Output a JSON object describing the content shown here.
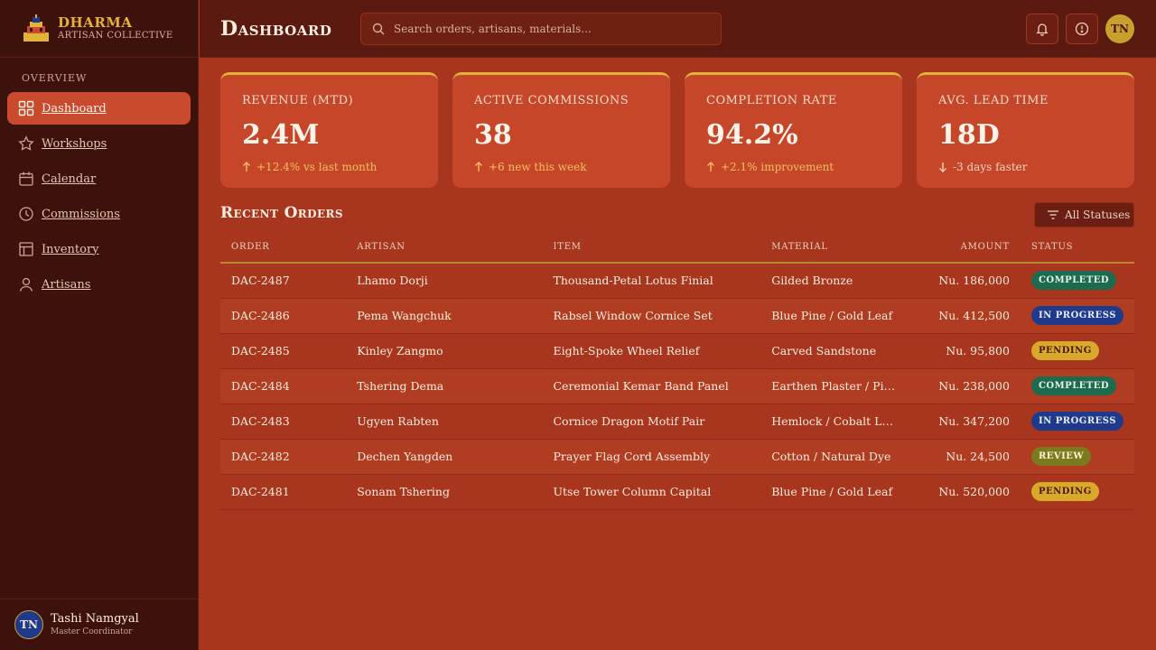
{
  "brand": {
    "name": "DHARMA",
    "subtitle": "ARTISAN COLLECTIVE"
  },
  "sidebar": {
    "section_label": "OVERVIEW",
    "items": [
      {
        "label": "Dashboard",
        "icon": "grid-icon",
        "active": true
      },
      {
        "label": "Workshops",
        "icon": "star-icon",
        "active": false
      },
      {
        "label": "Calendar",
        "icon": "calendar-icon",
        "active": false
      },
      {
        "label": "Commissions",
        "icon": "clock-icon",
        "active": false
      },
      {
        "label": "Inventory",
        "icon": "table-icon",
        "active": false
      },
      {
        "label": "Artisans",
        "icon": "user-icon",
        "active": false
      }
    ]
  },
  "user": {
    "initials": "TN",
    "name": "Tashi Namgyal",
    "role": "Master Coordinator"
  },
  "header": {
    "title": "Dashboard",
    "search_placeholder": "Search orders, artisans, materials...",
    "avatar_initials": "TN"
  },
  "kpis": [
    {
      "label": "REVENUE (MTD)",
      "value": "2.4M",
      "delta": "+12.4% vs last month",
      "direction": "up"
    },
    {
      "label": "ACTIVE COMMISSIONS",
      "value": "38",
      "delta": "+6 new this week",
      "direction": "up"
    },
    {
      "label": "COMPLETION RATE",
      "value": "94.2%",
      "delta": "+2.1% improvement",
      "direction": "up"
    },
    {
      "label": "AVG. LEAD TIME",
      "value": "18D",
      "delta": "-3 days faster",
      "direction": "down"
    }
  ],
  "orders": {
    "title": "Recent Orders",
    "filter_label": "All Statuses",
    "columns": [
      "ORDER",
      "ARTISAN",
      "ITEM",
      "MATERIAL",
      "AMOUNT",
      "STATUS"
    ],
    "rows": [
      {
        "order": "DAC-2487",
        "artisan": "Lhamo Dorji",
        "item": "Thousand-Petal Lotus Finial",
        "material": "Gilded Bronze",
        "amount": "Nu. 186,000",
        "status": "COMPLETED",
        "status_key": "completed"
      },
      {
        "order": "DAC-2486",
        "artisan": "Pema Wangchuk",
        "item": "Rabsel Window Cornice Set",
        "material": "Blue Pine / Gold Leaf",
        "amount": "Nu. 412,500",
        "status": "IN PROGRESS",
        "status_key": "inprogress"
      },
      {
        "order": "DAC-2485",
        "artisan": "Kinley Zangmo",
        "item": "Eight-Spoke Wheel Relief",
        "material": "Carved Sandstone",
        "amount": "Nu. 95,800",
        "status": "PENDING",
        "status_key": "pending"
      },
      {
        "order": "DAC-2484",
        "artisan": "Tshering Dema",
        "item": "Ceremonial Kemar Band Panel",
        "material": "Earthen Plaster / Pigm...",
        "amount": "Nu. 238,000",
        "status": "COMPLETED",
        "status_key": "completed"
      },
      {
        "order": "DAC-2483",
        "artisan": "Ugyen Rabten",
        "item": "Cornice Dragon Motif Pair",
        "material": "Hemlock / Cobalt Lacq...",
        "amount": "Nu. 347,200",
        "status": "IN PROGRESS",
        "status_key": "inprogress"
      },
      {
        "order": "DAC-2482",
        "artisan": "Dechen Yangden",
        "item": "Prayer Flag Cord Assembly",
        "material": "Cotton / Natural Dye",
        "amount": "Nu. 24,500",
        "status": "REVIEW",
        "status_key": "review"
      },
      {
        "order": "DAC-2481",
        "artisan": "Sonam Tshering",
        "item": "Utse Tower Column Capital",
        "material": "Blue Pine / Gold Leaf",
        "amount": "Nu. 520,000",
        "status": "PENDING",
        "status_key": "pending"
      }
    ]
  },
  "colors": {
    "sidebar_bg": "#3e120c",
    "main_bg": "#a8351d",
    "card_bg": "#c6462a",
    "accent_gold": "#e2b33a",
    "active_nav": "#c94a2c"
  }
}
